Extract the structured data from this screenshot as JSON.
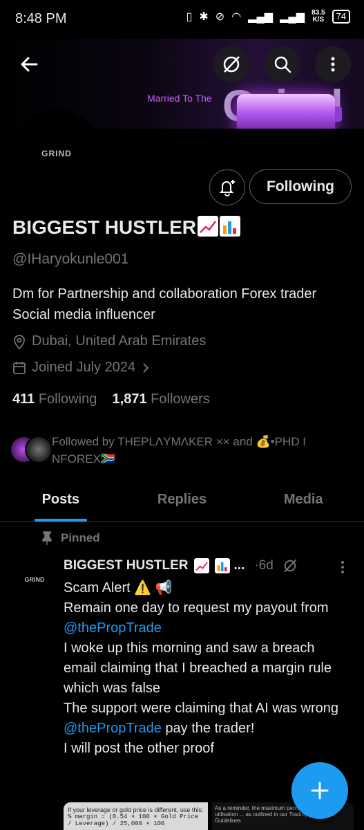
{
  "status_bar": {
    "time": "8:48 PM",
    "net_speed_value": "83.5",
    "net_speed_unit": "K/S",
    "battery": "74"
  },
  "banner": {
    "tagline": "Married To The",
    "word": "Grind"
  },
  "profile": {
    "avatar_text": "GRIND",
    "name": "BIGGEST HUSTLER",
    "handle": "@IHaryokunle001",
    "bio": "Dm for Partnership and collaboration  Forex trader  Social media influencer",
    "location": "Dubai, United Arab Emirates",
    "joined": "Joined July 2024",
    "following_count": "411",
    "following_label": "Following",
    "followers_count": "1,871",
    "followers_label": "Followers",
    "followed_by": "Followed by THEPLΛYMΛKER ×× and 💰•PHD I NFOREX🇿🇦",
    "follow_button": "Following"
  },
  "tabs": [
    {
      "label": "Posts",
      "active": true
    },
    {
      "label": "Replies",
      "active": false
    },
    {
      "label": "Media",
      "active": false
    }
  ],
  "post": {
    "pinned_label": "Pinned",
    "author": "BIGGEST HUSTLER",
    "ellipsis": "...",
    "time": "·6d",
    "line1": "Scam Alert ⚠️ 📢",
    "line2": "Remain one day to request my payout from",
    "mention": "@thePropTrade",
    "line3": "I woke up this morning and saw a breach email claiming that I breached a margin rule which was false",
    "line4": "The support were claiming that AI was wrong",
    "line5": "pay the trader!",
    "line6": "I will post the other proof",
    "media_left_title": "If your leverage or gold price is different, use this:",
    "media_left_formula": "% margin = (0.54 × 100 × Gold Price / Leverage) / 25,000 × 100",
    "media_right_text": "As a reminder, the maximum permitted margin utilisation ... as outlined in our Trading Rules and Guidelines"
  },
  "colors": {
    "accent": "#1d9bf0",
    "muted": "#71767b",
    "border": "#2f3336",
    "text": "#e7e9ea"
  }
}
